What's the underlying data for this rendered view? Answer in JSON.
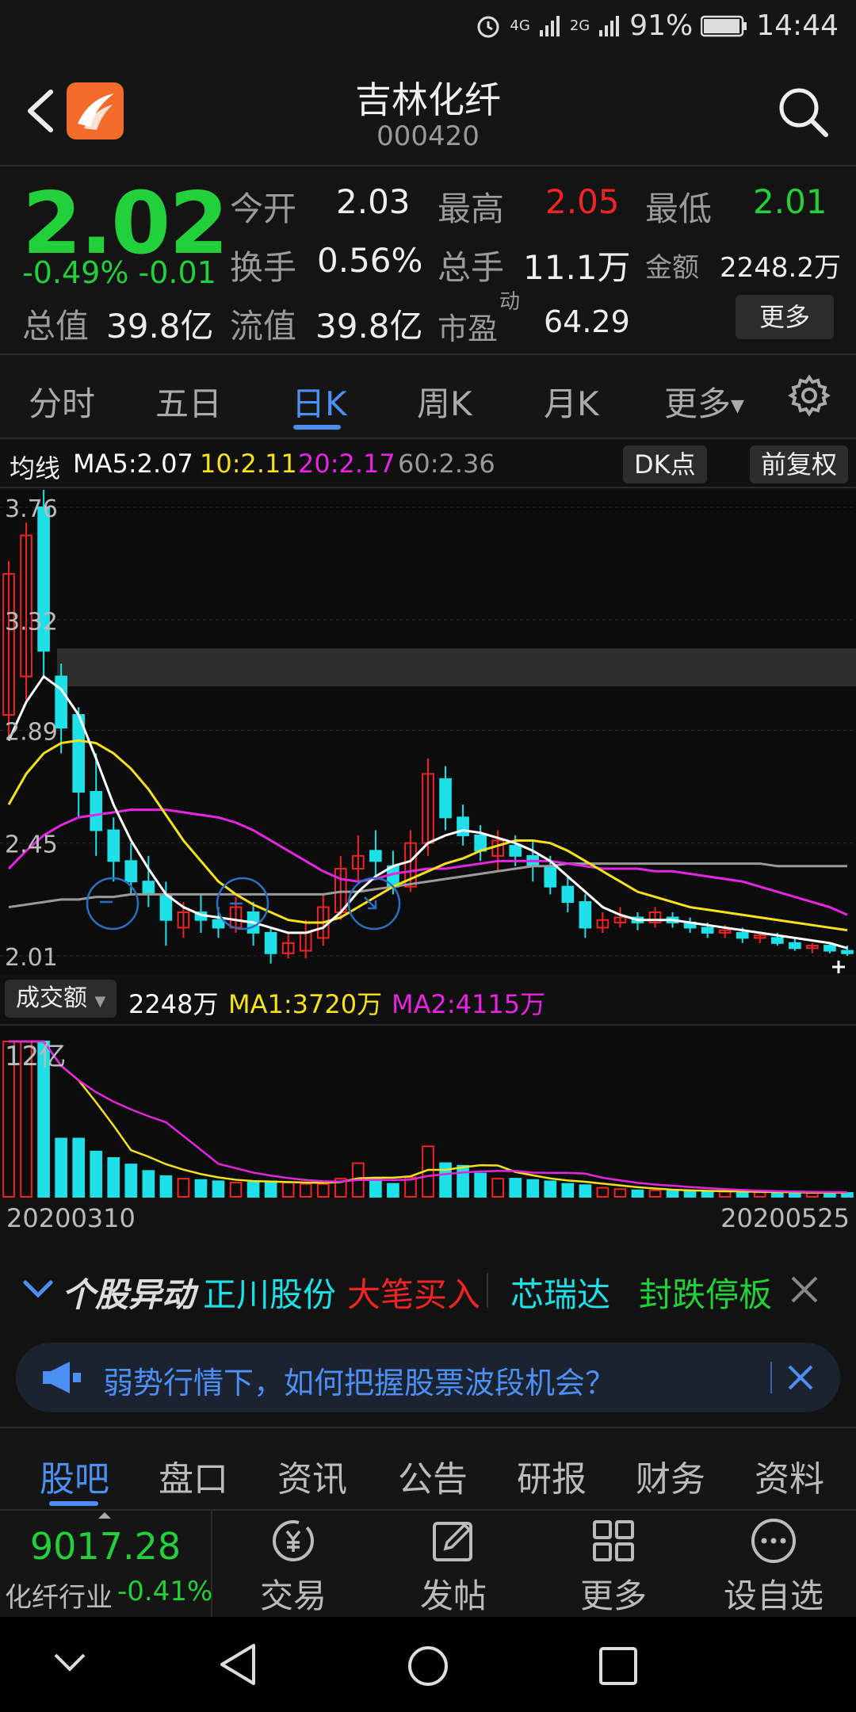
{
  "status": {
    "net1": "4G",
    "net2": "2G",
    "battery": "91%",
    "time": "14:44"
  },
  "header": {
    "title": "吉林化纤",
    "code": "000420"
  },
  "quote": {
    "price": "2.02",
    "change": "-0.49% -0.01",
    "open_label": "今开",
    "open": "2.03",
    "high_label": "最高",
    "high": "2.05",
    "low_label": "最低",
    "low": "2.01",
    "turnover_label": "换手",
    "turnover": "0.56%",
    "volume_label": "总手",
    "volume": "11.1万",
    "amount_label": "金额",
    "amount": "2248.2万",
    "mcap_label": "总值",
    "mcap": "39.8亿",
    "float_label": "流值",
    "float": "39.8亿",
    "pe_label": "市盈",
    "pe_sup": "动",
    "pe": "64.29",
    "more": "更多"
  },
  "period_tabs": [
    "分时",
    "五日",
    "日K",
    "周K",
    "月K",
    "更多"
  ],
  "active_period": 2,
  "ma": {
    "label": "均线",
    "ma5": "MA5:2.07",
    "ma10": "10:2.11",
    "ma20": "20:2.17",
    "ma60": "60:2.36",
    "dk": "DK点",
    "adj": "前复权"
  },
  "price_axis": [
    "3.76",
    "3.32",
    "2.89",
    "2.45",
    "2.01"
  ],
  "volume": {
    "select": "成交额",
    "value": "2248万",
    "ma1": "MA1:3720万",
    "ma2": "MA2:4115万",
    "axis": "12亿"
  },
  "dates": {
    "start": "20200310",
    "end": "20200525"
  },
  "abnormal": {
    "label": "个股异动",
    "s1": "正川股份",
    "t1": "大笔买入",
    "s2": "芯瑞达",
    "t2": "封跌停板"
  },
  "banner": {
    "text": "弱势行情下，如何把握股票波段机会？"
  },
  "bottom_tabs": [
    "股吧",
    "盘口",
    "资讯",
    "公告",
    "研报",
    "财务",
    "资料"
  ],
  "active_bottom": 0,
  "index": {
    "value": "9017.28",
    "name": "化纤行业",
    "change": "-0.41%"
  },
  "actions": [
    "交易",
    "发帖",
    "更多",
    "设自选"
  ],
  "colors": {
    "up": "#f02424",
    "down": "#1de0e8",
    "ma5": "#ffffff",
    "ma10": "#f5e21a",
    "ma20": "#e625e0",
    "ma60": "#9a9a9a",
    "accent": "#4c8ff5"
  },
  "chart_data": {
    "type": "candlestick",
    "ylim": [
      2.01,
      3.76
    ],
    "candles": [
      [
        2.95,
        3.5,
        3.55,
        2.85
      ],
      [
        3.1,
        3.65,
        3.7,
        3.0
      ],
      [
        3.76,
        3.2,
        3.9,
        3.1
      ],
      [
        3.1,
        2.9,
        3.15,
        2.8
      ],
      [
        2.95,
        2.65,
        2.98,
        2.55
      ],
      [
        2.65,
        2.5,
        2.8,
        2.4
      ],
      [
        2.5,
        2.38,
        2.55,
        2.3
      ],
      [
        2.38,
        2.3,
        2.45,
        2.25
      ],
      [
        2.3,
        2.25,
        2.4,
        2.2
      ],
      [
        2.25,
        2.15,
        2.3,
        2.05
      ],
      [
        2.12,
        2.18,
        2.22,
        2.08
      ],
      [
        2.18,
        2.15,
        2.25,
        2.1
      ],
      [
        2.15,
        2.12,
        2.2,
        2.08
      ],
      [
        2.12,
        2.2,
        2.24,
        2.1
      ],
      [
        2.18,
        2.1,
        2.22,
        2.05
      ],
      [
        2.1,
        2.02,
        2.12,
        1.98
      ],
      [
        2.02,
        2.06,
        2.1,
        2.0
      ],
      [
        2.03,
        2.1,
        2.15,
        2.0
      ],
      [
        2.08,
        2.2,
        2.25,
        2.05
      ],
      [
        2.18,
        2.35,
        2.4,
        2.15
      ],
      [
        2.35,
        2.4,
        2.48,
        2.3
      ],
      [
        2.42,
        2.38,
        2.5,
        2.32
      ],
      [
        2.36,
        2.28,
        2.42,
        2.25
      ],
      [
        2.28,
        2.45,
        2.5,
        2.26
      ],
      [
        2.45,
        2.72,
        2.78,
        2.4
      ],
      [
        2.7,
        2.55,
        2.75,
        2.5
      ],
      [
        2.55,
        2.48,
        2.6,
        2.44
      ],
      [
        2.48,
        2.42,
        2.52,
        2.38
      ],
      [
        2.4,
        2.46,
        2.5,
        2.34
      ],
      [
        2.44,
        2.4,
        2.48,
        2.36
      ],
      [
        2.4,
        2.36,
        2.46,
        2.3
      ],
      [
        2.36,
        2.28,
        2.4,
        2.25
      ],
      [
        2.28,
        2.22,
        2.32,
        2.18
      ],
      [
        2.22,
        2.12,
        2.25,
        2.08
      ],
      [
        2.12,
        2.15,
        2.18,
        2.1
      ],
      [
        2.14,
        2.16,
        2.2,
        2.12
      ],
      [
        2.16,
        2.14,
        2.18,
        2.11
      ],
      [
        2.14,
        2.18,
        2.2,
        2.12
      ],
      [
        2.16,
        2.14,
        2.18,
        2.12
      ],
      [
        2.14,
        2.12,
        2.16,
        2.1
      ],
      [
        2.12,
        2.1,
        2.14,
        2.08
      ],
      [
        2.1,
        2.11,
        2.13,
        2.08
      ],
      [
        2.1,
        2.08,
        2.12,
        2.06
      ],
      [
        2.08,
        2.09,
        2.1,
        2.06
      ],
      [
        2.08,
        2.06,
        2.1,
        2.05
      ],
      [
        2.06,
        2.04,
        2.08,
        2.03
      ],
      [
        2.04,
        2.05,
        2.06,
        2.02
      ],
      [
        2.05,
        2.03,
        2.06,
        2.02
      ],
      [
        2.03,
        2.02,
        2.05,
        2.01
      ]
    ],
    "ma5": [
      2.85,
      3.0,
      3.1,
      3.05,
      2.95,
      2.78,
      2.6,
      2.46,
      2.35,
      2.25,
      2.2,
      2.17,
      2.16,
      2.15,
      2.14,
      2.12,
      2.1,
      2.1,
      2.12,
      2.18,
      2.26,
      2.32,
      2.36,
      2.38,
      2.45,
      2.48,
      2.5,
      2.49,
      2.47,
      2.45,
      2.42,
      2.38,
      2.32,
      2.26,
      2.2,
      2.17,
      2.15,
      2.15,
      2.15,
      2.14,
      2.13,
      2.12,
      2.11,
      2.1,
      2.09,
      2.08,
      2.07,
      2.06,
      2.04
    ],
    "ma10": [
      2.6,
      2.72,
      2.8,
      2.84,
      2.85,
      2.84,
      2.8,
      2.74,
      2.66,
      2.56,
      2.46,
      2.38,
      2.3,
      2.25,
      2.21,
      2.18,
      2.15,
      2.14,
      2.14,
      2.16,
      2.2,
      2.24,
      2.28,
      2.31,
      2.34,
      2.37,
      2.39,
      2.42,
      2.44,
      2.46,
      2.46,
      2.45,
      2.42,
      2.38,
      2.34,
      2.3,
      2.26,
      2.24,
      2.22,
      2.2,
      2.19,
      2.18,
      2.17,
      2.16,
      2.15,
      2.14,
      2.13,
      2.12,
      2.11
    ],
    "ma20": [
      2.35,
      2.42,
      2.48,
      2.52,
      2.55,
      2.56,
      2.57,
      2.58,
      2.58,
      2.58,
      2.57,
      2.56,
      2.55,
      2.53,
      2.5,
      2.46,
      2.42,
      2.38,
      2.34,
      2.31,
      2.3,
      2.31,
      2.33,
      2.34,
      2.35,
      2.35,
      2.36,
      2.37,
      2.38,
      2.38,
      2.38,
      2.38,
      2.37,
      2.36,
      2.35,
      2.35,
      2.35,
      2.34,
      2.34,
      2.33,
      2.32,
      2.31,
      2.3,
      2.28,
      2.26,
      2.24,
      2.22,
      2.2,
      2.17
    ],
    "ma60": [
      2.2,
      2.21,
      2.22,
      2.23,
      2.23,
      2.24,
      2.24,
      2.25,
      2.25,
      2.25,
      2.25,
      2.25,
      2.25,
      2.25,
      2.25,
      2.25,
      2.25,
      2.25,
      2.25,
      2.26,
      2.26,
      2.27,
      2.28,
      2.29,
      2.3,
      2.31,
      2.32,
      2.33,
      2.34,
      2.35,
      2.36,
      2.36,
      2.37,
      2.37,
      2.37,
      2.37,
      2.37,
      2.37,
      2.37,
      2.37,
      2.37,
      2.37,
      2.37,
      2.37,
      2.36,
      2.36,
      2.36,
      2.36,
      2.36
    ],
    "volumes": [
      12,
      12,
      12,
      4.5,
      4.5,
      3.5,
      3.0,
      2.5,
      2.0,
      1.6,
      1.4,
      1.3,
      1.2,
      1.1,
      1.1,
      1.2,
      1.1,
      1.0,
      1.0,
      1.4,
      2.6,
      1.4,
      1.0,
      1.5,
      3.9,
      2.6,
      2.4,
      1.8,
      1.4,
      1.4,
      1.3,
      1.2,
      1.0,
      0.9,
      0.7,
      0.6,
      0.5,
      0.5,
      0.45,
      0.45,
      0.4,
      0.4,
      0.35,
      0.35,
      0.35,
      0.3,
      0.3,
      0.3,
      0.3
    ]
  }
}
